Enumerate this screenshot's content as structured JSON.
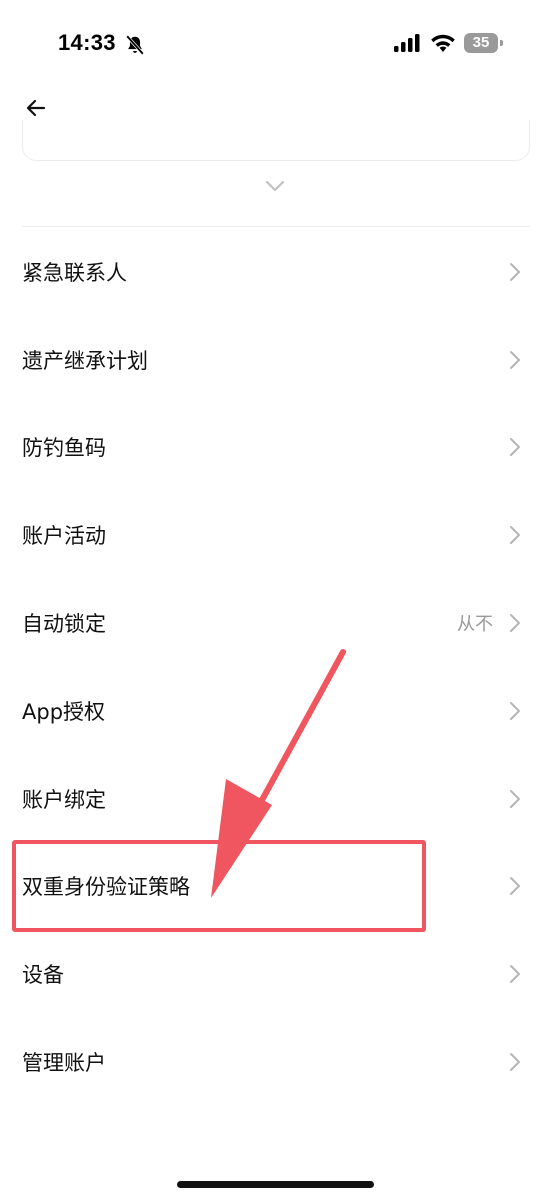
{
  "status_bar": {
    "time": "14:33",
    "battery_level": "35",
    "icons": [
      "bell-off-icon",
      "signal-icon",
      "wifi-icon",
      "battery-icon"
    ]
  },
  "header": {
    "back_icon": "arrow-left-icon",
    "expand_icon": "chevron-down-icon"
  },
  "menu": {
    "items": [
      {
        "label": "紧急联系人",
        "value": ""
      },
      {
        "label": "遗产继承计划",
        "value": ""
      },
      {
        "label": "防钓鱼码",
        "value": ""
      },
      {
        "label": "账户活动",
        "value": ""
      },
      {
        "label": "自动锁定",
        "value": "从不"
      },
      {
        "label": "App授权",
        "value": ""
      },
      {
        "label": "账户绑定",
        "value": ""
      },
      {
        "label": "双重身份验证策略",
        "value": ""
      },
      {
        "label": "设备",
        "value": ""
      },
      {
        "label": "管理账户",
        "value": ""
      }
    ]
  },
  "annotation": {
    "highlighted_item": "双重身份验证策略",
    "color": "#f0565f"
  },
  "colors": {
    "text_primary": "#111111",
    "text_secondary": "#9a9a9a",
    "chevron": "#b5b5b5",
    "divider": "#ececec",
    "annotation": "#f0565f"
  }
}
